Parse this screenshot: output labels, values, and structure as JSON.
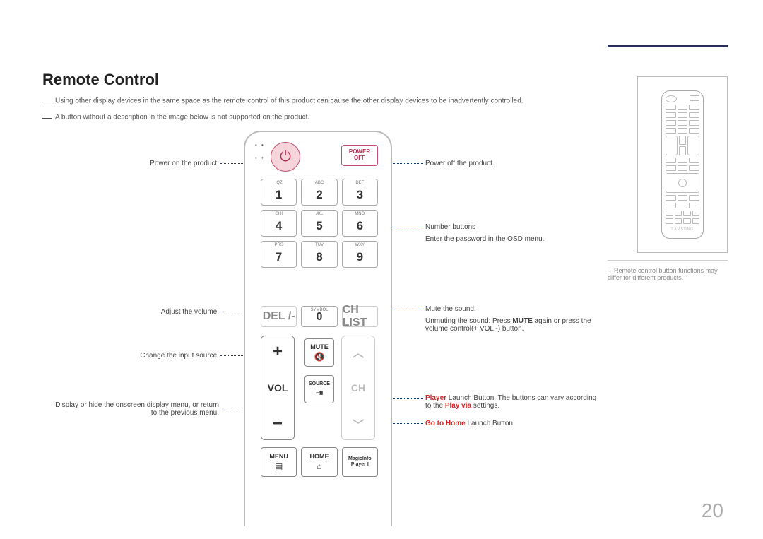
{
  "title": "Remote Control",
  "notes": {
    "n1": "Using other display devices in the same space as the remote control of this product can cause the other display devices to be inadvertently controlled.",
    "n2": "A button without a description in the image below is not supported on the product."
  },
  "left": {
    "power_on": "Power on the product.",
    "volume": "Adjust the volume.",
    "source": "Change the input source.",
    "menu": "Display or hide the onscreen display menu, or return to the previous menu."
  },
  "right": {
    "power_off": "Power off the product.",
    "numbers_l1": "Number buttons",
    "numbers_l2": "Enter the password in the OSD menu.",
    "mute_l1": "Mute the sound.",
    "mute_l2a": "Unmuting the sound: Press ",
    "mute_l2b": "MUTE",
    "mute_l2c": " again or press the volume control(+ VOL -) button.",
    "player_red": "Player",
    "player_rest": " Launch Button. The buttons can vary according to the ",
    "player_red2": "Play via",
    "player_rest2": " settings.",
    "home_red": "Go to Home",
    "home_rest": " Launch Button."
  },
  "remote": {
    "power_off_l1": "POWER",
    "power_off_l2": "OFF",
    "keys": [
      {
        "sub": ".QZ",
        "n": "1"
      },
      {
        "sub": "ABC",
        "n": "2"
      },
      {
        "sub": "DEF",
        "n": "3"
      },
      {
        "sub": "GHI",
        "n": "4"
      },
      {
        "sub": "JKL",
        "n": "5"
      },
      {
        "sub": "MNO",
        "n": "6"
      },
      {
        "sub": "PRS",
        "n": "7"
      },
      {
        "sub": "TUV",
        "n": "8"
      },
      {
        "sub": "WXY",
        "n": "9"
      }
    ],
    "row4": {
      "del": "DEL /-",
      "sym_sub": "SYMBOL",
      "zero": "0",
      "chlist": "CH LIST"
    },
    "vol": "VOL",
    "ch": "CH",
    "mute": "MUTE",
    "source": "SOURCE",
    "menu": "MENU",
    "home": "HOME",
    "magic_l1": "MagicInfo",
    "magic_l2": "Player I"
  },
  "thumb_note": "Remote control button functions may differ for different products.",
  "mini_brand": "SAMSUNG",
  "page": "20"
}
